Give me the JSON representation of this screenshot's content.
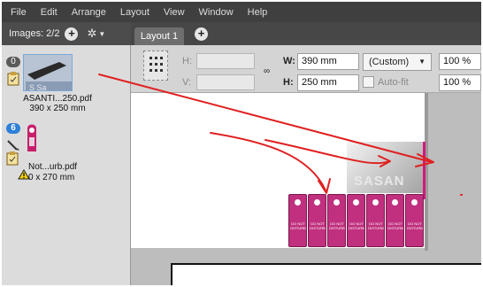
{
  "menubar": {
    "items": [
      "File",
      "Edit",
      "Arrange",
      "Layout",
      "View",
      "Window",
      "Help"
    ]
  },
  "images_bar": {
    "label": "Images: 2/2",
    "add": "+",
    "gear": "✲"
  },
  "tabs": {
    "layout": "Layout 1",
    "add": "+"
  },
  "images": [
    {
      "badge": "0",
      "name": "ASANTI...250.pdf",
      "size": "390 x 250 mm"
    },
    {
      "badge": "6",
      "name": "Not...urb.pdf",
      "size": "0 x 270 mm"
    }
  ],
  "toolbar": {
    "h_label": "H:",
    "v_label": "V:",
    "w_label": "W:",
    "w_value": "390 mm",
    "h2_label": "H:",
    "h2_value": "250 mm",
    "size_select": "(Custom)",
    "autofit_label": "Auto-fit",
    "scale1": "100 %",
    "scale2": "100 %"
  },
  "canvas": {
    "photo_text": "SASAN",
    "hanger_text": "DO NOT DISTURB",
    "hanger_count": 7,
    "colors": {
      "hanger": "#c0307e",
      "arrow": "#e02020",
      "accent": "#2e7fd8"
    }
  }
}
